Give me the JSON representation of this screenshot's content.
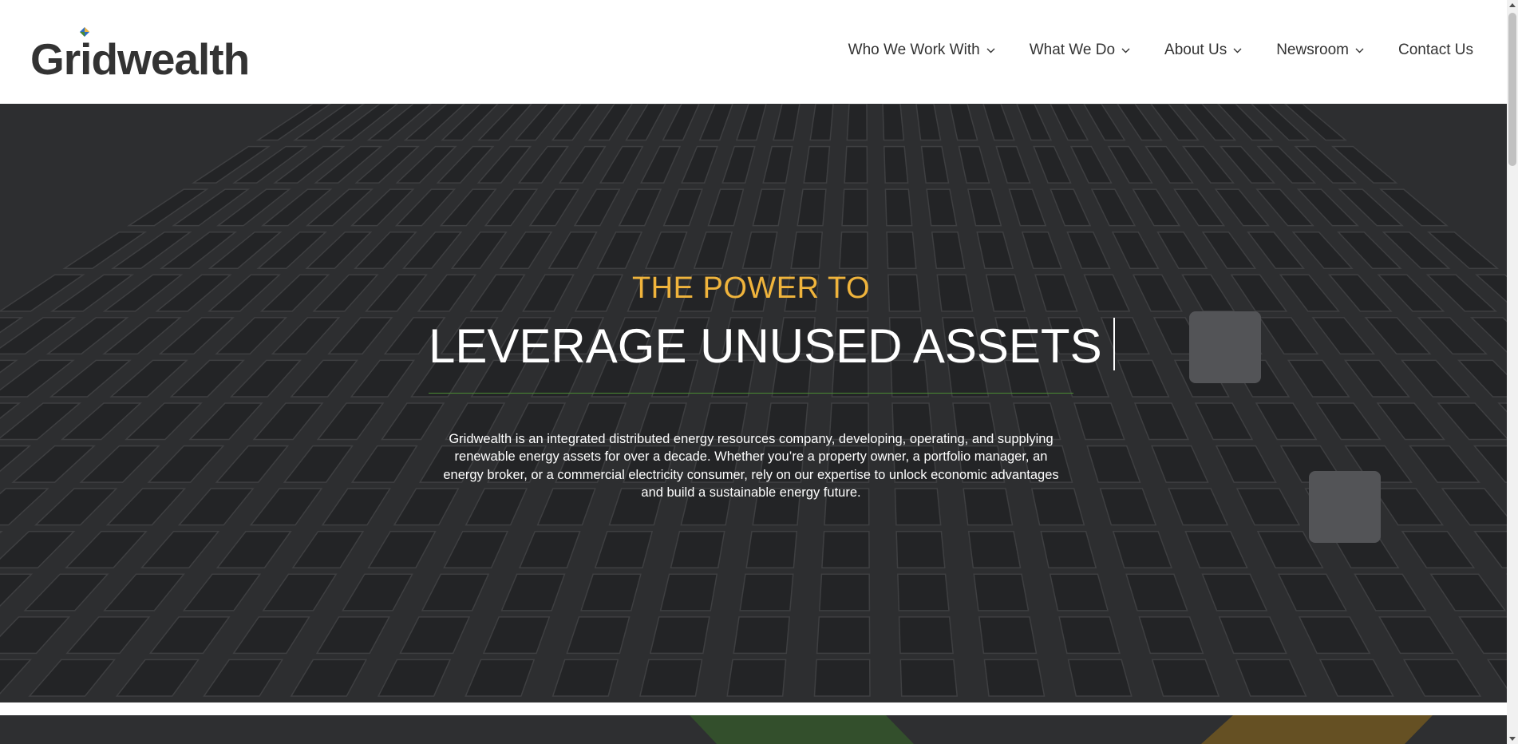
{
  "header": {
    "logo_text": "Gridwealth",
    "nav": [
      {
        "label": "Who We Work With",
        "has_dropdown": true
      },
      {
        "label": "What We Do",
        "has_dropdown": true
      },
      {
        "label": "About Us",
        "has_dropdown": true
      },
      {
        "label": "Newsroom",
        "has_dropdown": true
      },
      {
        "label": "Contact Us",
        "has_dropdown": false
      }
    ]
  },
  "hero": {
    "eyebrow": "THE POWER TO",
    "headline": "LEVERAGE UNUSED ASSETS",
    "description": "Gridwealth is an integrated distributed energy resources company, developing, operating, and supplying renewable energy assets for over a decade. Whether you’re a property owner, a portfolio manager, an energy broker, or a commercial electricity consumer, rely on our expertise to unlock economic advantages and build a sustainable energy future."
  },
  "colors": {
    "accent_yellow": "#f0b43c",
    "accent_green": "#4a8a32",
    "text_dark": "#333333",
    "hero_overlay": "#2b2c2e"
  },
  "icons": {
    "logo_mark": "gridwealth-diamond-icon",
    "dropdown": "chevron-down-icon"
  }
}
